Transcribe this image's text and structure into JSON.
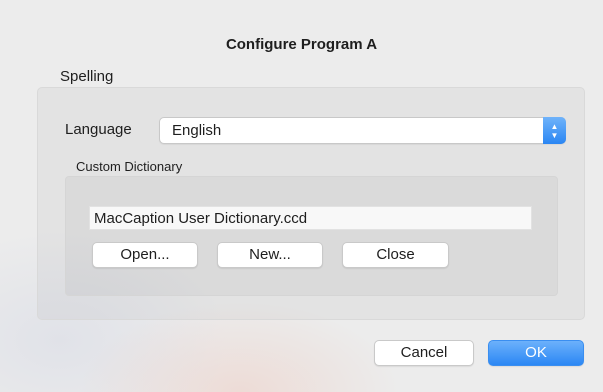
{
  "dialog": {
    "title": "Configure Program A"
  },
  "spelling_group": {
    "title": "Spelling",
    "language_label": "Language",
    "language_value": "English"
  },
  "custom_dictionary": {
    "title": "Custom Dictionary",
    "file_name": "MacCaption User Dictionary.ccd",
    "open_label": "Open...",
    "new_label": "New...",
    "close_label": "Close"
  },
  "footer": {
    "cancel_label": "Cancel",
    "ok_label": "OK"
  },
  "colors": {
    "accent": "#2b87f4",
    "background": "#ececec"
  },
  "icons": {
    "popup_arrows": "up-down-chevron-icon"
  }
}
